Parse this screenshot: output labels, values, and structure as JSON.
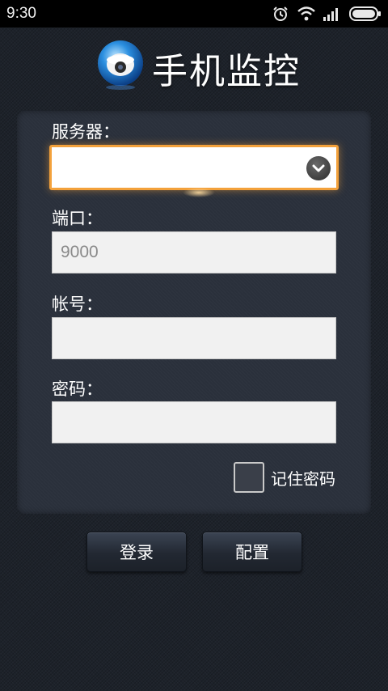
{
  "status_bar": {
    "time": "9:30",
    "icons": [
      "alarm-icon",
      "wifi-icon",
      "signal-icon",
      "battery-icon"
    ]
  },
  "header": {
    "title": "手机监控",
    "logo_icon": "camera-globe-icon"
  },
  "form": {
    "server": {
      "label": "服务器：",
      "value": ""
    },
    "port": {
      "label": "端口：",
      "value": "",
      "placeholder": "9000"
    },
    "account": {
      "label": "帐号：",
      "value": "",
      "placeholder": ""
    },
    "password": {
      "label": "密码：",
      "value": "",
      "placeholder": ""
    },
    "remember": {
      "label": "记住密码",
      "checked": false
    }
  },
  "actions": {
    "login_label": "登录",
    "config_label": "配置"
  },
  "colors": {
    "background": "#1d222a",
    "panel": "#2a303b",
    "accent_focus": "#f3a13b"
  }
}
